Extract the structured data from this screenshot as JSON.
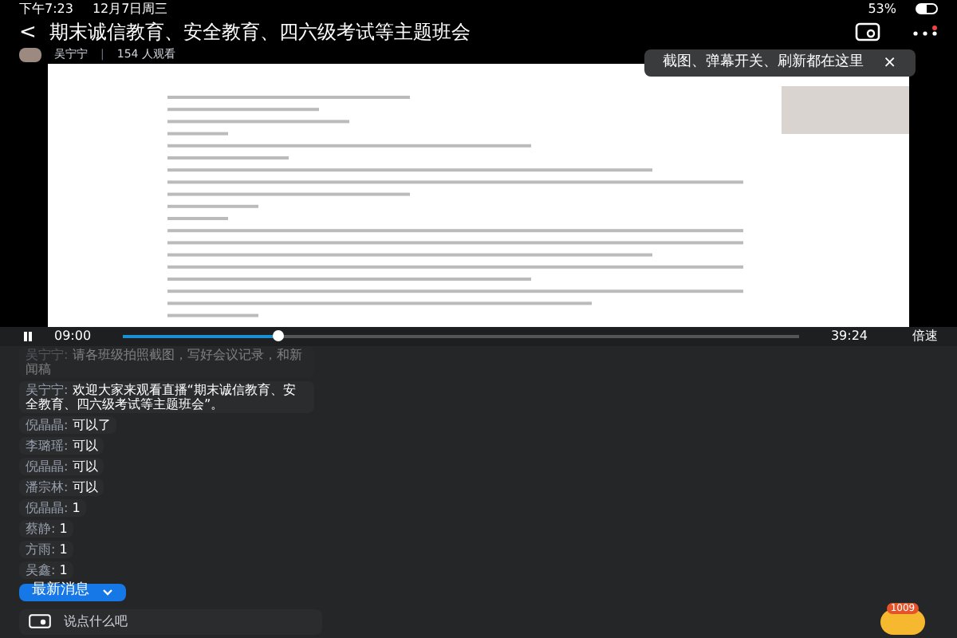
{
  "status_bar": {
    "time": "下午7:23",
    "date": "12月7日周三",
    "battery": "53%"
  },
  "header": {
    "back": "<",
    "title": "期末诚信教育、安全教育、四六级考试等主题班会",
    "streamer": "吴宁宁",
    "separator": "|",
    "viewers": "154 人观看",
    "tip": "截图、弹幕开关、刷新都在这里",
    "tip_close": "×"
  },
  "player": {
    "playing": true,
    "current": "09:00",
    "duration": "39:24",
    "level": 0.228,
    "speed": "倍速"
  },
  "chat": {
    "messages": [
      {
        "user": "吴宁宁:",
        "text": "请各班级拍照截图，写好会议记录，和新闻稿",
        "faded": true
      },
      {
        "user": "吴宁宁:",
        "text": "欢迎大家来观看直播“期末诚信教育、安全教育、四六级考试等主题班会”。",
        "faded": false
      },
      {
        "user": "倪晶晶:",
        "text": "可以了",
        "faded": false
      },
      {
        "user": "李璐瑶:",
        "text": "可以",
        "faded": false
      },
      {
        "user": "倪晶晶:",
        "text": "可以",
        "faded": false
      },
      {
        "user": "潘宗林:",
        "text": "可以",
        "faded": false
      },
      {
        "user": "倪晶晶:",
        "text": "1",
        "faded": false
      },
      {
        "user": "蔡静:",
        "text": "1",
        "faded": false
      },
      {
        "user": "方雨:",
        "text": "1",
        "faded": false
      },
      {
        "user": "吴鑫:",
        "text": "1",
        "faded": false
      }
    ],
    "new_messages": "最新消息",
    "input_placeholder": "说点什么吧",
    "gift_count": "1009"
  }
}
